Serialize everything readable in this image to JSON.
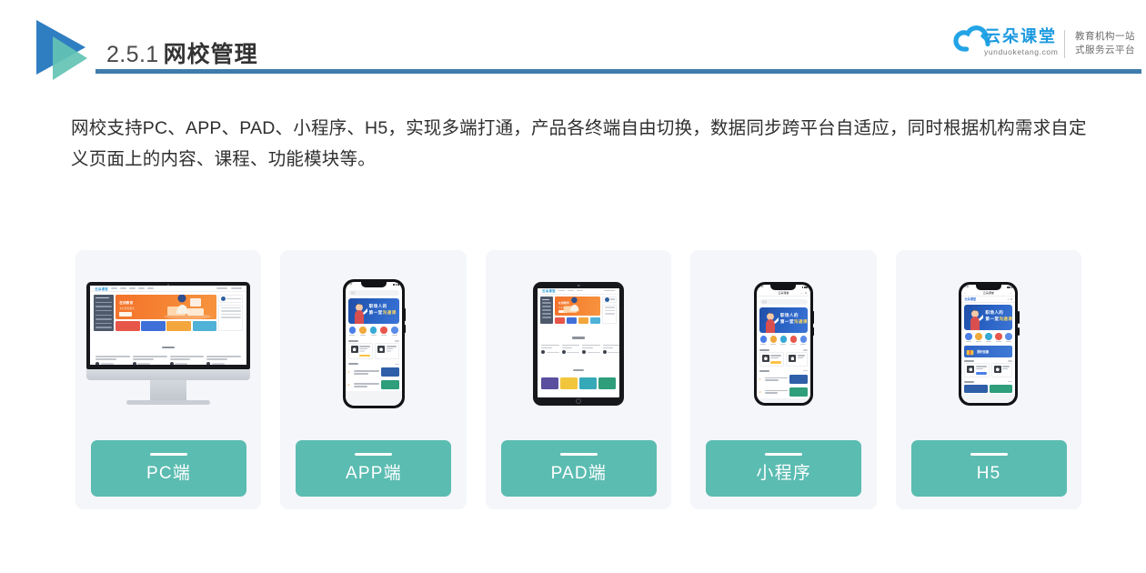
{
  "header": {
    "section_number": "2.5.1",
    "section_title": "网校管理",
    "accent_rule_color": "#3f7cab",
    "logo_blue": "#2f7ec2",
    "logo_teal": "#63c3b4"
  },
  "brand": {
    "name_cn": "云朵课堂",
    "name_en": "yunduoketang.com",
    "tagline_line1": "教育机构一站",
    "tagline_line2": "式服务云平台",
    "brand_color": "#1c9ae0"
  },
  "lead": {
    "paragraph": "网校支持PC、APP、PAD、小程序、H5，实现多端打通，产品各终端自由切换，数据同步跨平台自适应，同时根据机构需求自定义页面上的内容、课程、功能模块等。"
  },
  "cards": [
    {
      "label": "PC端",
      "device": "imac",
      "icon": "desktop-monitor-icon"
    },
    {
      "label": "APP端",
      "device": "iphone",
      "icon": "mobile-phone-icon"
    },
    {
      "label": "PAD端",
      "device": "ipad",
      "icon": "tablet-icon"
    },
    {
      "label": "小程序",
      "device": "iphone",
      "icon": "mini-program-phone-icon"
    },
    {
      "label": "H5",
      "device": "iphone",
      "icon": "h5-phone-icon"
    }
  ],
  "theme": {
    "card_background": "#f4f6fa",
    "label_teal": "#5bbcb1",
    "banner_blue": "#2a63c4",
    "banner_orange": "#f58634",
    "text_dark": "#2f2f2f"
  },
  "mock_screens": {
    "web_banner_title": "在线教育",
    "web_banner_sub": "专业课程服务",
    "app_banner_line1": "职场人的",
    "app_banner_line2_plain": "第一堂",
    "app_banner_line2_accent": "沟通课",
    "status_time": "9:41",
    "mini_program_title": "云朵课堂",
    "h5_browser_title": "云朵课堂"
  }
}
